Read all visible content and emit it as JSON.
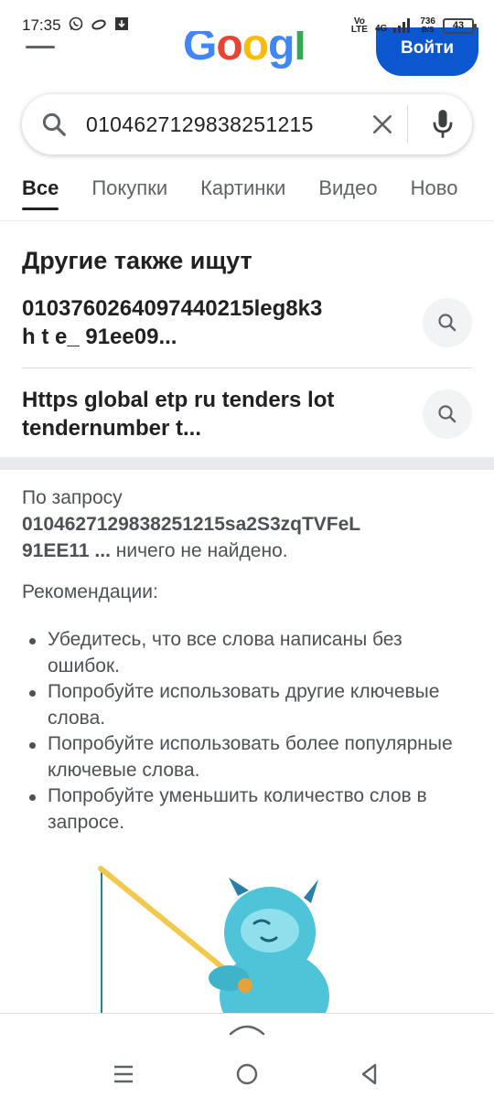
{
  "status_bar": {
    "time": "17:35",
    "net_top": "Vo",
    "net_bottom": "LTE",
    "signal_label": "4G",
    "speed_value": "736",
    "speed_unit": "B/S",
    "battery": "43",
    "icons": [
      "whatsapp-icon",
      "link-icon",
      "download-icon",
      "signal-icon",
      "battery-icon"
    ]
  },
  "header": {
    "logo_letters": [
      "G",
      "o",
      "o",
      "g",
      "l",
      "e"
    ],
    "logo_colors": [
      "#4285F4",
      "#EA4335",
      "#FBBC05",
      "#4285F4",
      "#34A853",
      "#EA4335"
    ],
    "signin_label": "Войти",
    "accent": "#0b57d0"
  },
  "search": {
    "query": "010462712983825121​5",
    "clear_icon": "close-icon",
    "mic_icon": "mic-icon"
  },
  "tabs": [
    {
      "label": "Все",
      "active": true
    },
    {
      "label": "Покупки",
      "active": false
    },
    {
      "label": "Картинки",
      "active": false
    },
    {
      "label": "Видео",
      "active": false
    },
    {
      "label": "Ново",
      "active": false
    }
  ],
  "others_search": {
    "title": "Другие также ищут",
    "items": [
      {
        "line1": "010376026409744021​5leg8k3",
        "line2": "h t e_ 91ee09..."
      },
      {
        "line1": "Https global etp ru tenders lot",
        "line2": "tendernumber t..."
      }
    ]
  },
  "no_results": {
    "prefix": "По запросу",
    "query_line1": "010462712983825121​5sa2S3zqTVFeL",
    "query_line2": "91EE11 ...",
    "suffix": " ничего не найдено.",
    "recommendations_title": "Рекомендации:",
    "recommendations": [
      "Убедитесь, что все слова написаны без ошибок.",
      "Попробуйте использовать другие ключевые слова.",
      "Попробуйте использовать более популярные ключевые слова.",
      "Попробуйте уменьшить количество слов в запросе."
    ]
  },
  "bottom_nav": {
    "icons": [
      "chevron-up-icon",
      "recents-icon",
      "home-icon",
      "back-icon"
    ]
  }
}
